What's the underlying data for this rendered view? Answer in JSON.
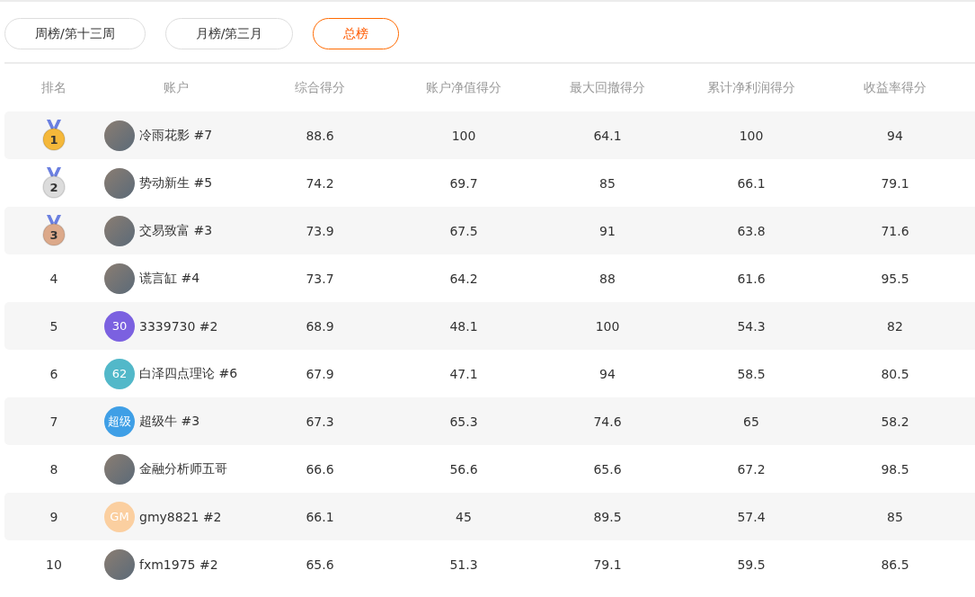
{
  "tabs": [
    {
      "label": "周榜/第十三周",
      "selected": false
    },
    {
      "label": "月榜/第三月",
      "selected": false
    },
    {
      "label": "总榜",
      "selected": true
    }
  ],
  "table": {
    "columns": [
      "排名",
      "账户",
      "综合得分",
      "账户净值得分",
      "最大回撤得分",
      "累计净利润得分",
      "收益率得分"
    ],
    "rows": [
      {
        "rank": {
          "kind": "medal",
          "text": "1",
          "color": "#f5b83a"
        },
        "avatar": {
          "kind": "photo"
        },
        "account": "冷雨花影 #7",
        "scores": [
          "88.6",
          "100",
          "64.1",
          "100",
          "94"
        ]
      },
      {
        "rank": {
          "kind": "medal",
          "text": "2",
          "color": "#dcdcdc"
        },
        "avatar": {
          "kind": "photo"
        },
        "account": "势动新生 #5",
        "scores": [
          "74.2",
          "69.7",
          "85",
          "66.1",
          "79.1"
        ]
      },
      {
        "rank": {
          "kind": "medal",
          "text": "3",
          "color": "#dca98a"
        },
        "avatar": {
          "kind": "photo"
        },
        "account": "交易致富 #3",
        "scores": [
          "73.9",
          "67.5",
          "91",
          "63.8",
          "71.6"
        ]
      },
      {
        "rank": {
          "kind": "number",
          "text": "4"
        },
        "avatar": {
          "kind": "photo"
        },
        "account": "谎言缸 #4",
        "scores": [
          "73.7",
          "64.2",
          "88",
          "61.6",
          "95.5"
        ]
      },
      {
        "rank": {
          "kind": "number",
          "text": "5"
        },
        "avatar": {
          "kind": "initials",
          "text": "30",
          "color": "#7b61e0"
        },
        "account": "3339730 #2",
        "scores": [
          "68.9",
          "48.1",
          "100",
          "54.3",
          "82"
        ]
      },
      {
        "rank": {
          "kind": "number",
          "text": "6"
        },
        "avatar": {
          "kind": "initials",
          "text": "62",
          "color": "#52b8c9"
        },
        "account": "白泽四点理论 #6",
        "scores": [
          "67.9",
          "47.1",
          "94",
          "58.5",
          "80.5"
        ]
      },
      {
        "rank": {
          "kind": "number",
          "text": "7"
        },
        "avatar": {
          "kind": "initials",
          "text": "超级",
          "color": "#3f9fe6"
        },
        "account": "超级牛 #3",
        "scores": [
          "67.3",
          "65.3",
          "74.6",
          "65",
          "58.2"
        ]
      },
      {
        "rank": {
          "kind": "number",
          "text": "8"
        },
        "avatar": {
          "kind": "photo"
        },
        "account": "金融分析师五哥",
        "scores": [
          "66.6",
          "56.6",
          "65.6",
          "67.2",
          "98.5"
        ]
      },
      {
        "rank": {
          "kind": "number",
          "text": "9"
        },
        "avatar": {
          "kind": "initials",
          "text": "GM",
          "color": "#fbcfa0"
        },
        "account": "gmy8821 #2",
        "scores": [
          "66.1",
          "45",
          "89.5",
          "57.4",
          "85"
        ]
      },
      {
        "rank": {
          "kind": "number",
          "text": "10"
        },
        "avatar": {
          "kind": "photo"
        },
        "account": "fxm1975 #2",
        "scores": [
          "65.6",
          "51.3",
          "79.1",
          "59.5",
          "86.5"
        ]
      }
    ]
  }
}
